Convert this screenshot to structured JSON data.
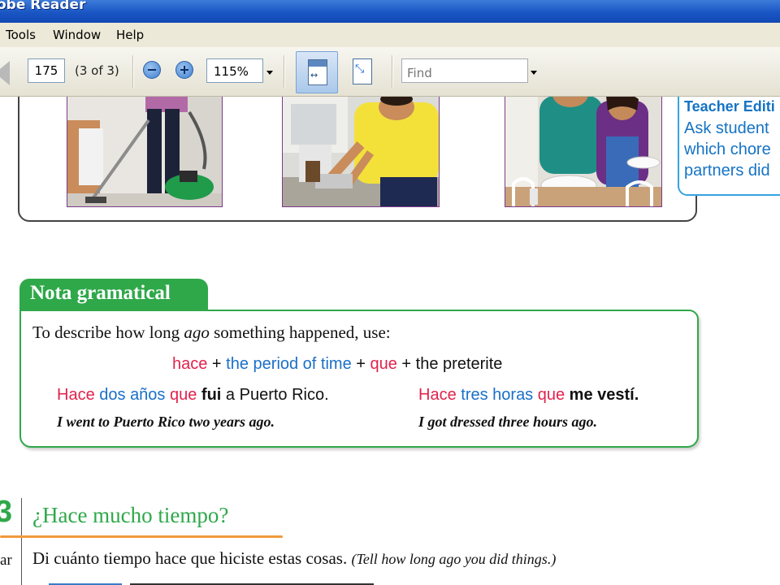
{
  "window": {
    "title": "obe Reader"
  },
  "menu": {
    "items": [
      "Tools",
      "Window",
      "Help"
    ]
  },
  "toolbar": {
    "page_number": "175",
    "page_of": "(3 of 3)",
    "zoom_value": "115%",
    "find_placeholder": "Find"
  },
  "document": {
    "teacher_edition": {
      "heading": "Teacher Editi",
      "lines": [
        "Ask student",
        "which chore",
        "partners did"
      ]
    },
    "nota": {
      "title": "Nota gramatical",
      "intro_before": "To describe how long ",
      "intro_em": "ago",
      "intro_after": " something happened, use:",
      "formula": {
        "hace": "hace",
        "plus1": " + ",
        "period": "the period of time",
        "plus2": " + ",
        "que": "que",
        "plus3": " + ",
        "preterite": "the preterite"
      },
      "example1": {
        "hace": "Hace",
        "period": " dos años ",
        "que": "que",
        "verb": " fui",
        "rest": " a Puerto Rico.",
        "translation": "I went to Puerto Rico two years ago."
      },
      "example2": {
        "hace": "Hace",
        "period": " tres horas ",
        "que": "que",
        "rest": " me vestí.",
        "translation": "I got dressed three hours ago."
      }
    },
    "exercise": {
      "number": "3",
      "title": "¿Hace mucho tiempo?",
      "side_label": "ar",
      "instruction": "Di cuánto tiempo hace que hiciste estas cosas. ",
      "instruction_en": "(Tell how long ago you did things.)"
    }
  },
  "colors": {
    "accent_green": "#2fa84a",
    "red": "#e0234d",
    "blue": "#1a6fc8",
    "title_bar": "#1a56c4"
  }
}
